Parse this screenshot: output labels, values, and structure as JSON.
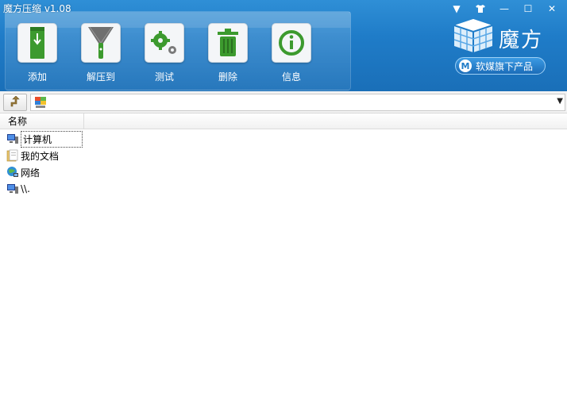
{
  "window": {
    "title": "魔方压缩 v1.08",
    "controls": [
      "▼",
      "👕",
      "—",
      "☐",
      "✕"
    ]
  },
  "toolbar": {
    "items": [
      {
        "label": "添加",
        "icon": "add-archive-icon"
      },
      {
        "label": "解压到",
        "icon": "extract-zipper-icon"
      },
      {
        "label": "测试",
        "icon": "gears-test-icon"
      },
      {
        "label": "删除",
        "icon": "trash-delete-icon"
      },
      {
        "label": "信息",
        "icon": "info-icon"
      }
    ]
  },
  "brand": {
    "name": "魔方",
    "badge": "软媒旗下产品",
    "badge_letter": "M"
  },
  "address": {
    "value": ""
  },
  "list": {
    "column_name": "名称",
    "rows": [
      {
        "label": "计算机",
        "icon": "computer-icon"
      },
      {
        "label": "我的文档",
        "icon": "documents-folder-icon"
      },
      {
        "label": "网络",
        "icon": "network-icon"
      },
      {
        "label": "\\\\.",
        "icon": "computer-icon"
      }
    ]
  },
  "colors": {
    "header_blue": "#1f7cc8",
    "tool_green": "#3c9a2e"
  }
}
